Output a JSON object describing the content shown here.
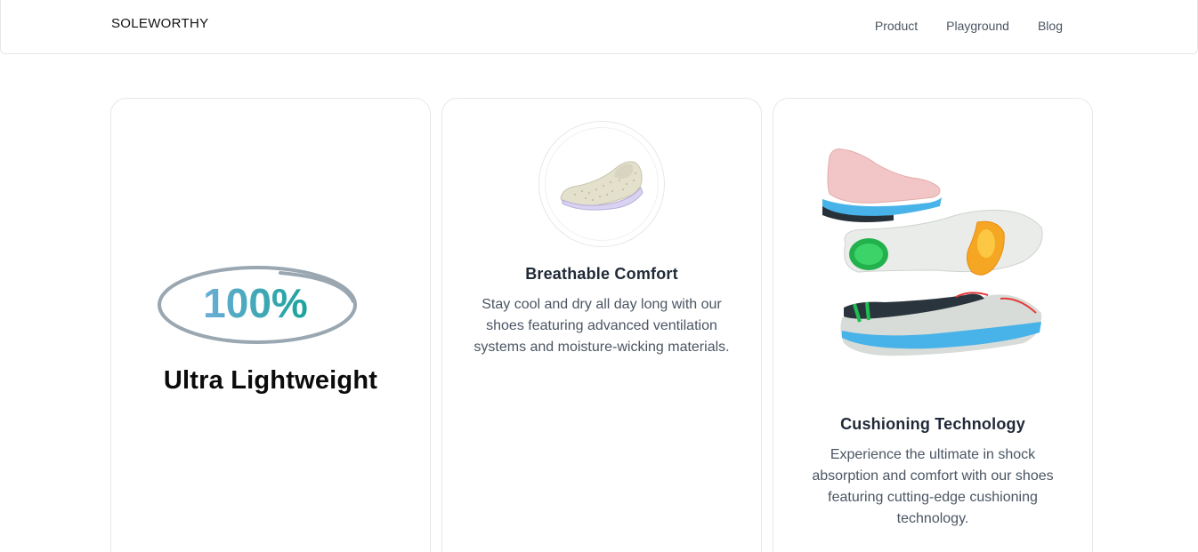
{
  "header": {
    "brand": "SOLEWORTHY",
    "nav": [
      "Product",
      "Playground",
      "Blog"
    ]
  },
  "features": {
    "lightweight": {
      "badge_text": "100%",
      "title": "Ultra Lightweight"
    },
    "breathable": {
      "title": "Breathable Comfort",
      "description": "Stay cool and dry all day long with our shoes featuring advanced ventilation systems and moisture-wicking materials."
    },
    "cushioning": {
      "title": "Cushioning Technology",
      "description": "Experience the ultimate in shock absorption and comfort with our shoes featuring cutting-edge cushioning technology."
    }
  },
  "colors": {
    "badge_ring": "#9aa7b1",
    "badge_gradient_start": "#6aaed6",
    "badge_gradient_end": "#1ba39c",
    "border": "#e5e7eb"
  }
}
